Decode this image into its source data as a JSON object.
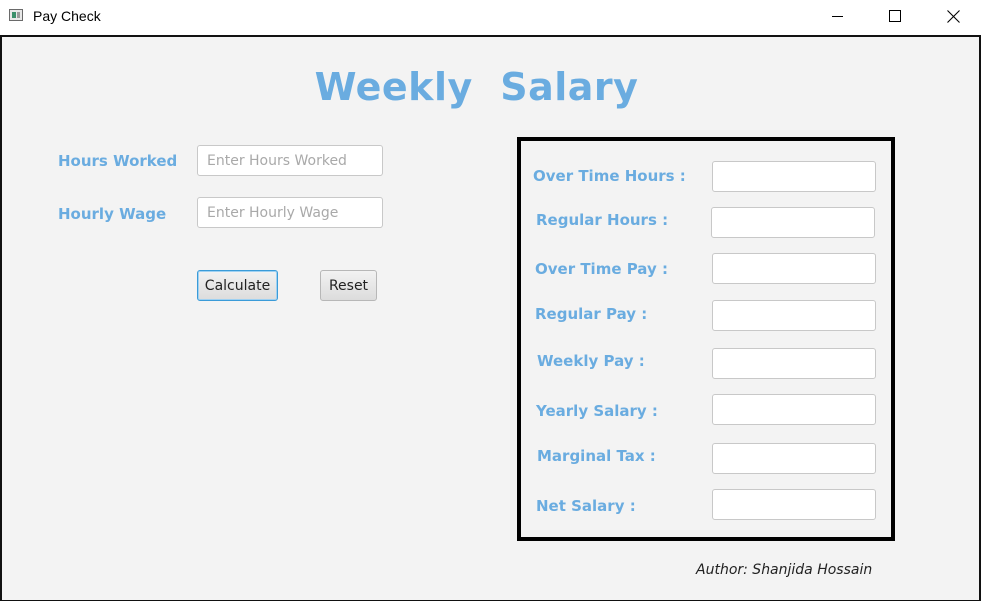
{
  "window": {
    "title": "Pay Check",
    "controls": {
      "minimize_icon": "minimize-icon",
      "maximize_icon": "maximize-icon",
      "close_icon": "close-icon"
    }
  },
  "heading": "Weekly  Salary",
  "inputs": {
    "hours_worked": {
      "label": "Hours Worked",
      "value": "",
      "placeholder": "Enter Hours Worked"
    },
    "hourly_wage": {
      "label": "Hourly Wage",
      "value": "",
      "placeholder": "Enter Hourly Wage"
    }
  },
  "buttons": {
    "calculate": "Calculate",
    "reset": "Reset"
  },
  "results": [
    {
      "label": "Over Time Hours :",
      "value": ""
    },
    {
      "label": "Regular Hours :",
      "value": ""
    },
    {
      "label": "Over Time Pay :",
      "value": ""
    },
    {
      "label": "Regular Pay :",
      "value": ""
    },
    {
      "label": "Weekly Pay :",
      "value": ""
    },
    {
      "label": "Yearly Salary :",
      "value": ""
    },
    {
      "label": "Marginal Tax :",
      "value": ""
    },
    {
      "label": "Net Salary :",
      "value": ""
    }
  ],
  "author": "Author: Shanjida Hossain",
  "colors": {
    "accent_label": "#6aace0",
    "background": "#f3f3f3",
    "focus_border": "#3a9bd8"
  }
}
